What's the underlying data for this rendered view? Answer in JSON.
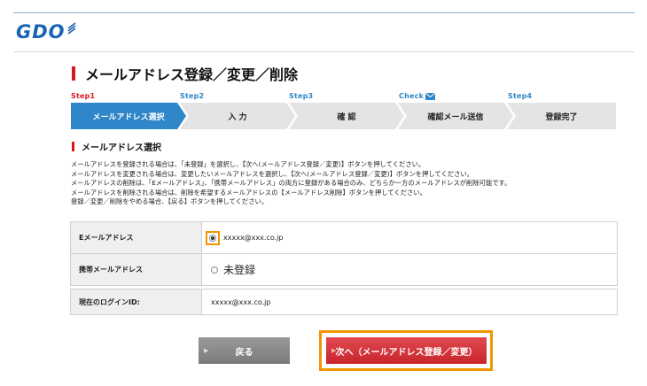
{
  "logo": {
    "text": "GDO"
  },
  "page": {
    "title": "メールアドレス登録／変更／削除"
  },
  "steps": [
    {
      "label": "Step1",
      "name": "メールアドレス選択",
      "active": true
    },
    {
      "label": "Step2",
      "name": "入 力",
      "active": false
    },
    {
      "label": "Step3",
      "name": "確 認",
      "active": false
    },
    {
      "label": "Check",
      "name": "確認メール送信",
      "active": false
    },
    {
      "label": "Step4",
      "name": "登録完了",
      "active": false
    }
  ],
  "section": {
    "title": "メールアドレス選択"
  },
  "instructions": [
    "メールアドレスを登録される場合は、「未登録」を選択し、【次へ(メールアドレス登録／変更)】ボタンを押してください。",
    "メールアドレスを変更される場合は、変更したいメールアドレスを選択し、【次へ(メールアドレス登録／変更)】ボタンを押してください。",
    "メールアドレスの削除は、「Eメールアドレス」、「携帯メールアドレス」の両方に登録がある場合のみ、どちらか一方のメールアドレスが削除可能です。",
    "メールアドレスを削除される場合は、削除を希望するメールアドレスの【メールアドレス削除】ボタンを押してください。",
    "登録／変更／削除をやめる場合、【戻る】ボタンを押してください。"
  ],
  "form": {
    "email": {
      "label": "Eメールアドレス",
      "value": "xxxxx@xxx.co.jp"
    },
    "mobile": {
      "label": "携帯メールアドレス",
      "value": "未登録"
    },
    "login": {
      "label": "現在のログインID:",
      "value": "xxxxx@xxx.co.jp"
    }
  },
  "buttons": {
    "back": "戻る",
    "next": "次へ（メールアドレス登録／変更）"
  },
  "colors": {
    "brand": "#1a63b5",
    "step_active": "#2f86c8",
    "accent_red": "#d6191f",
    "highlight": "#f29600"
  }
}
